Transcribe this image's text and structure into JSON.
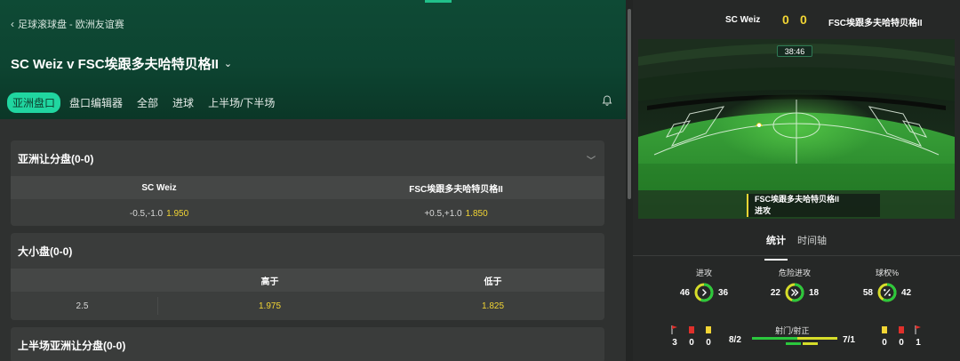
{
  "breadcrumb": "足球滚球盘 - 欧洲友谊赛",
  "match_title": "SC Weiz v FSC埃跟多夫哈特贝格II",
  "tabs": [
    {
      "label": "亚洲盘口",
      "active": true
    },
    {
      "label": "盘口编辑器",
      "active": false
    },
    {
      "label": "全部",
      "active": false
    },
    {
      "label": "进球",
      "active": false
    },
    {
      "label": "上半场/下半场",
      "active": false
    }
  ],
  "markets": {
    "asian_handicap": {
      "title": "亚洲让分盘(0-0)",
      "home_team": "SC Weiz",
      "away_team": "FSC埃跟多夫哈特贝格II",
      "home_line": "-0.5,-1.0",
      "home_odds": "1.950",
      "away_line": "+0.5,+1.0",
      "away_odds": "1.850"
    },
    "over_under": {
      "title": "大小盘(0-0)",
      "over_label": "高于",
      "under_label": "低于",
      "line": "2.5",
      "over_odds": "1.975",
      "under_odds": "1.825"
    },
    "first_half_asian": {
      "title": "上半场亚洲让分盘(0-0)"
    }
  },
  "scoreboard": {
    "home": "SC Weiz",
    "away": "FSC埃跟多夫哈特贝格II",
    "home_score": "0",
    "away_score": "0",
    "clock": "38:46",
    "event_team": "FSC埃跟多夫哈特贝格II",
    "event_type": "进攻"
  },
  "stat_tabs": {
    "stats": "统计",
    "timeline": "时间轴"
  },
  "stats": {
    "attacks": {
      "label": "进攻",
      "home": "46",
      "away": "36",
      "home_share": 0.56
    },
    "dangerous": {
      "label": "危险进攻",
      "home": "22",
      "away": "18",
      "home_share": 0.55
    },
    "possession": {
      "label": "球权%",
      "home": "58",
      "away": "42",
      "home_share": 0.58
    },
    "shots": {
      "label": "射门/射正",
      "home": "8/2",
      "away": "7/1",
      "home_share": 0.53
    }
  },
  "cards": {
    "home": {
      "corners": "3",
      "red": "0",
      "yellow": "0"
    },
    "away": {
      "yellow": "0",
      "red": "0",
      "corners": "1"
    }
  },
  "colors": {
    "accent": "#20d6a0",
    "odds": "#f2d534",
    "home": "#2bc83d",
    "away": "#d6dd2a"
  }
}
